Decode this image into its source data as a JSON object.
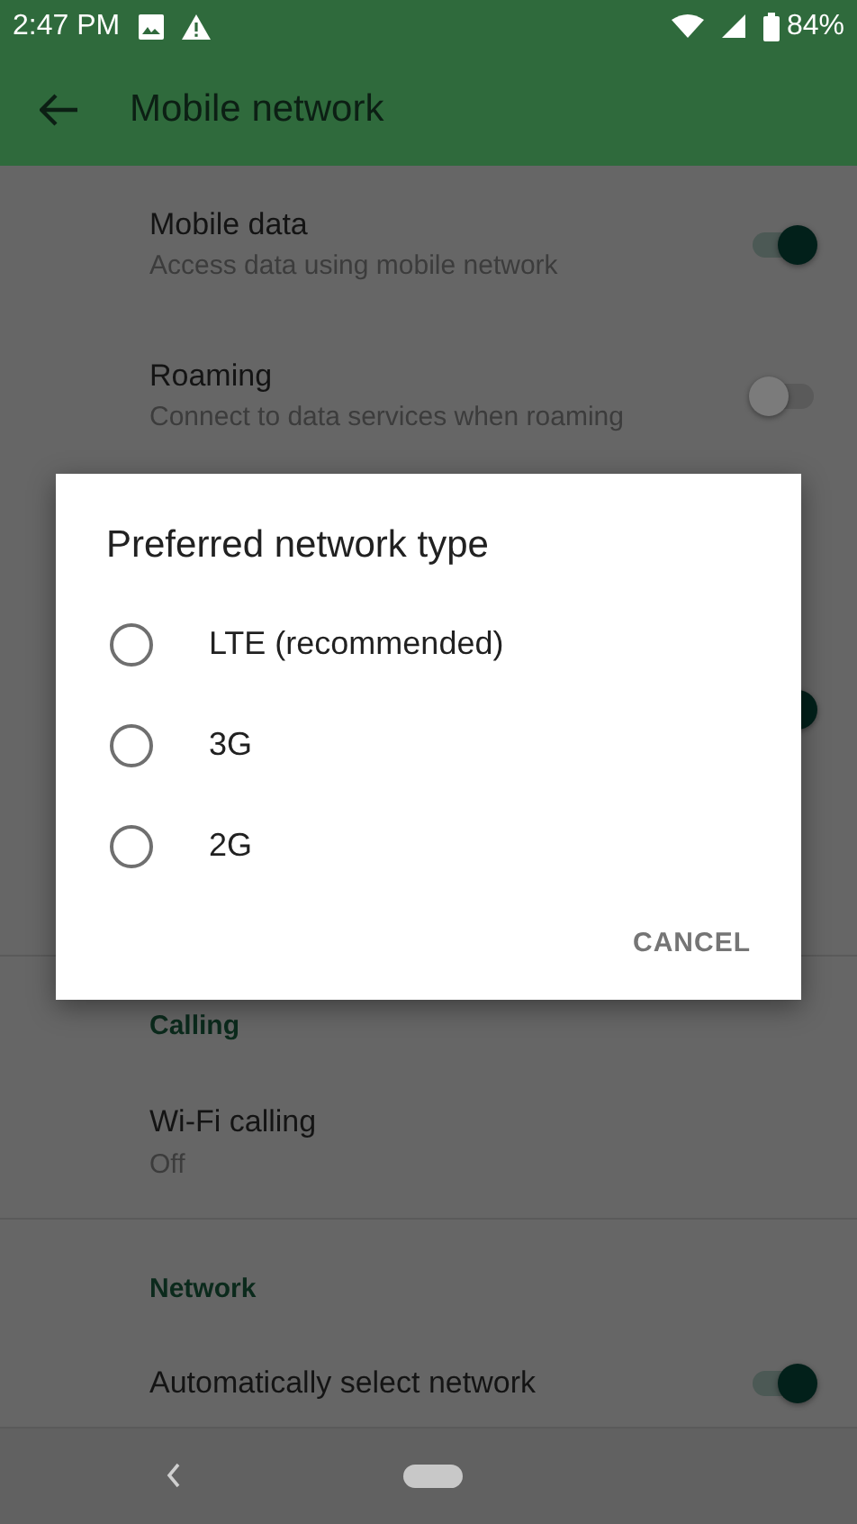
{
  "status_bar": {
    "time": "2:47 PM",
    "battery": "84%"
  },
  "app_bar": {
    "title": "Mobile network"
  },
  "settings": [
    {
      "kind": "toggle",
      "title": "Mobile data",
      "subtitle": "Access data using mobile network",
      "on": true
    },
    {
      "kind": "toggle",
      "title": "Roaming",
      "subtitle": "Connect to data services when roaming",
      "on": false
    },
    {
      "kind": "hidden-toggle",
      "on": true
    },
    {
      "kind": "header",
      "title": "Calling"
    },
    {
      "kind": "text",
      "title": "Wi-Fi calling",
      "subtitle": "Off"
    },
    {
      "kind": "header",
      "title": "Network"
    },
    {
      "kind": "toggle",
      "title": "Automatically select network",
      "on": true
    }
  ],
  "dialog": {
    "title": "Preferred network type",
    "options": [
      {
        "label": "LTE (recommended)",
        "selected": false
      },
      {
        "label": "3G",
        "selected": false
      },
      {
        "label": "2G",
        "selected": false
      }
    ],
    "buttons": [
      "CANCEL"
    ]
  }
}
